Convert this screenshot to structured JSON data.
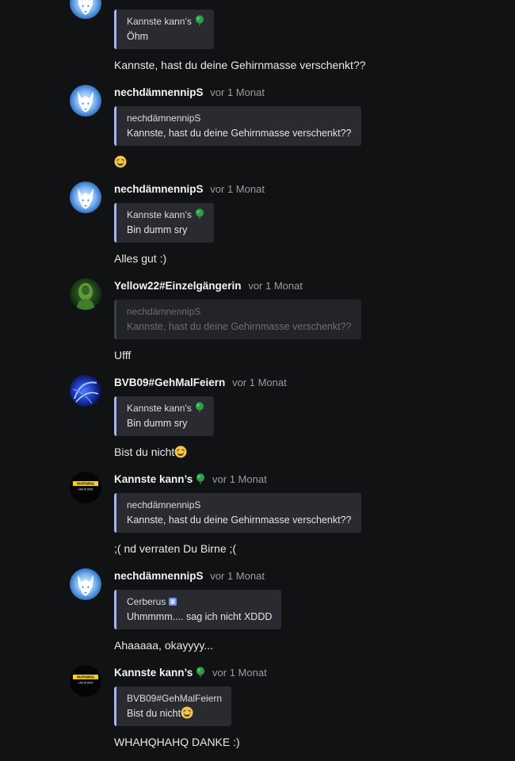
{
  "messages": [
    {
      "quote": {
        "author": "Kannste kann’s",
        "text": "Öhm"
      },
      "body": "Kannste, hast du deine Gehirnmasse verschenkt??"
    },
    {
      "author": "nechdämnennipS",
      "time": "vor 1 Monat",
      "quote": {
        "author": "nechdämnennipS",
        "text": "Kannste, hast du deine Gehirnmasse verschenkt??"
      },
      "body": ""
    },
    {
      "author": "nechdämnennipS",
      "time": "vor 1 Monat",
      "quote": {
        "author": "Kannste kann’s",
        "text": "Bin dumm sry"
      },
      "body": "Alles gut :)"
    },
    {
      "author": "Yellow22#Einzelgängerin",
      "time": "vor 1 Monat",
      "quote": {
        "author": "nechdämnennipS",
        "text": "Kannste, hast du deine Gehirnmasse verschenkt??"
      },
      "body": "Ufff"
    },
    {
      "author": "BVB09#GehMalFeiern",
      "time": "vor 1 Monat",
      "quote": {
        "author": "Kannste kann’s",
        "text": "Bin dumm sry"
      },
      "body": "Bist du nicht"
    },
    {
      "author": "Kannste kann’s",
      "time": "vor 1 Monat",
      "quote": {
        "author": "nechdämnennipS",
        "text": "Kannste, hast du deine Gehirnmasse verschenkt??"
      },
      "body": ";( nd verraten Du Birne ;("
    },
    {
      "author": "nechdämnennipS",
      "time": "vor 1 Monat",
      "quote": {
        "author": "Cerberus",
        "text": "Uhmmmm.... sag ich nicht XDDD"
      },
      "body": "Ahaaaaa, okayyyy..."
    },
    {
      "author": "Kannste kann’s",
      "time": "vor 1 Monat",
      "quote": {
        "author": "BVB09#GehMalFeiern",
        "text": "Bist du nicht"
      },
      "body": "WHAHQHAHQ DANKE :)"
    }
  ],
  "avatar_texts": {
    "warning": "WARNING",
    "stupid": "I AM STUPID"
  },
  "colors": {
    "background": "#111214",
    "quote_bg": "#2a2b30",
    "quote_bar": "#a9b6e8",
    "tree": "#2e9e4a",
    "timestamp": "#9a9ca2"
  },
  "icons": [
    "wolf-avatar",
    "green-figure-avatar",
    "blue-swirl-avatar",
    "warning-avatar",
    "tree-icon",
    "grinning-squint-emoji",
    "lock-icon"
  ]
}
